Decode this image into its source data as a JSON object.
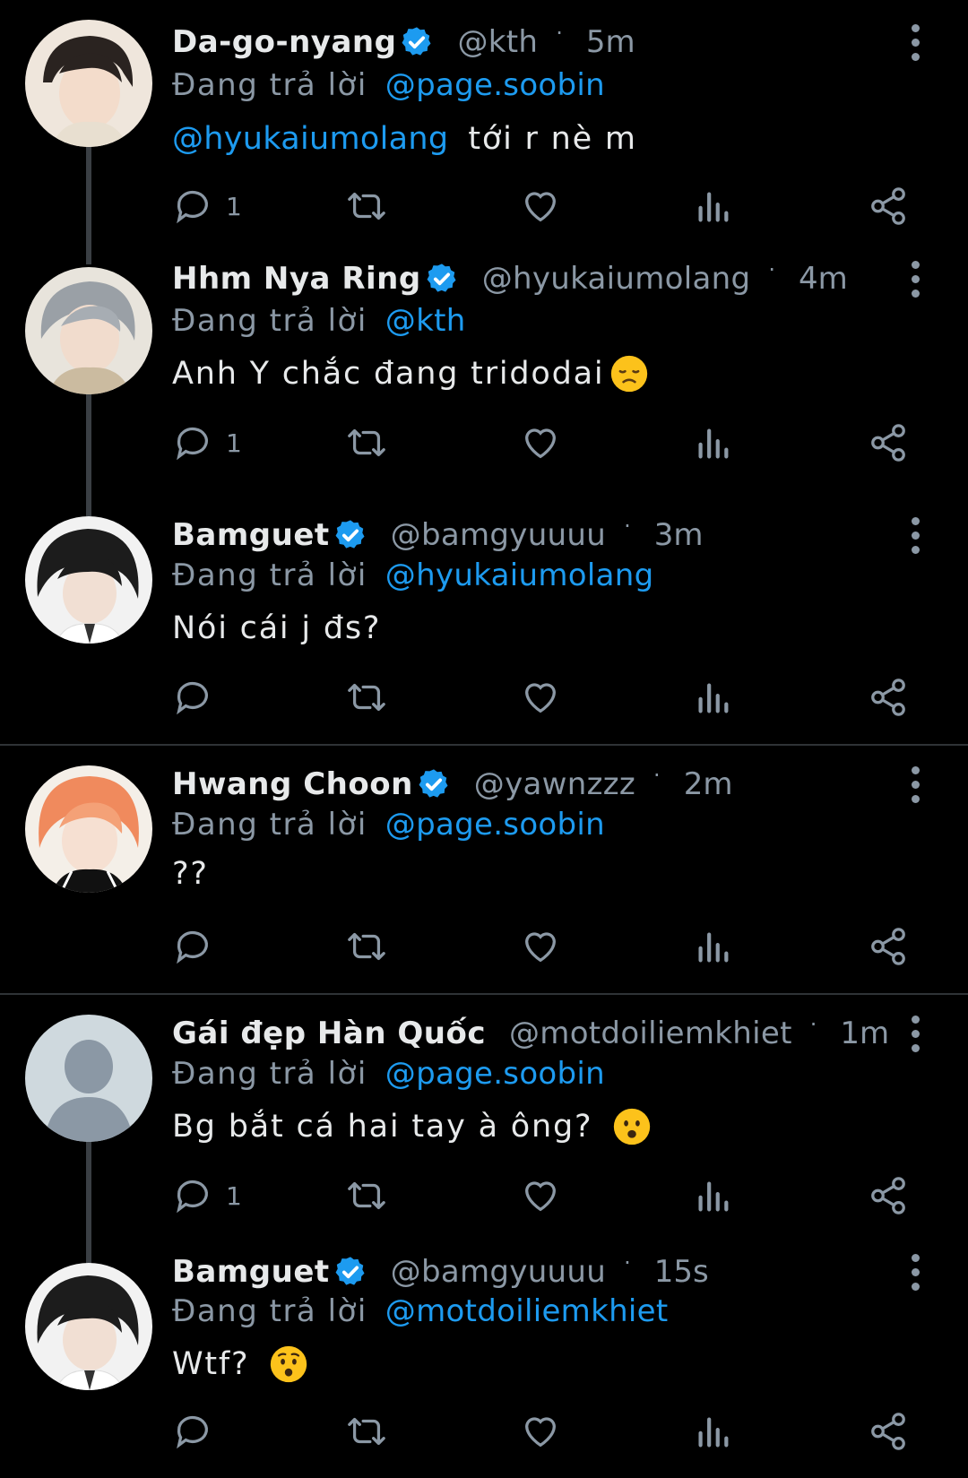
{
  "tweets": [
    {
      "name": "Da-go-nyang",
      "verified": true,
      "handle": "@kth",
      "time": "5m",
      "reply_prefix": "Đang trả lời",
      "reply_to": "@page.soobin",
      "mention": "@hyukaiumolang",
      "text": "tới r nè m",
      "reply_count": "1",
      "avatar_colors": [
        "#efe6dc",
        "#2a2320"
      ]
    },
    {
      "name": "Hhm Nya Ring",
      "verified": true,
      "handle": "@hyukaiumolang",
      "time": "4m",
      "reply_prefix": "Đang trả lời",
      "reply_to": "@kth",
      "text": "Anh Y chắc đang tridodai",
      "emoji": "disappointed-face",
      "reply_count": "1",
      "avatar_colors": [
        "#e8e4dc",
        "#9aa0a6"
      ]
    },
    {
      "name": "Bamguet",
      "verified": true,
      "handle": "@bamgyuuuu",
      "time": "3m",
      "reply_prefix": "Đang trả lời",
      "reply_to": "@hyukaiumolang",
      "text": "Nói cái j đs?",
      "reply_count": "",
      "avatar_colors": [
        "#f2f2f2",
        "#1c1c1c"
      ]
    },
    {
      "name": "Hwang Choon",
      "verified": true,
      "handle": "@yawnzzz",
      "time": "2m",
      "reply_prefix": "Đang trả lời",
      "reply_to": "@page.soobin",
      "text": "??",
      "reply_count": "",
      "avatar_colors": [
        "#f4efe8",
        "#f08a5d"
      ]
    },
    {
      "name": "Gái đẹp Hàn Quốc",
      "verified": false,
      "handle": "@motdoiliemkhiet",
      "time": "1m",
      "reply_prefix": "Đang trả lời",
      "reply_to": "@page.soobin",
      "text": "Bg bắt cá hai tay à ông?",
      "emoji": "frowning-open-mouth-face",
      "reply_count": "1",
      "avatar_colors": [
        "#cfd9de",
        "#8b98a5"
      ]
    },
    {
      "name": "Bamguet",
      "verified": true,
      "handle": "@bamgyuuuu",
      "time": "15s",
      "reply_prefix": "Đang trả lời",
      "reply_to": "@motdoiliemkhiet",
      "text": "Wtf?",
      "emoji": "hushed-face",
      "reply_count": "",
      "avatar_colors": [
        "#f2f2f2",
        "#1c1c1c"
      ]
    }
  ],
  "colors": {
    "background": "#000000",
    "text": "#e7e9ea",
    "muted": "#8b98a5",
    "accent": "#1d9bf0",
    "divider": "#2f3336",
    "thread_line": "#3a3f44"
  }
}
